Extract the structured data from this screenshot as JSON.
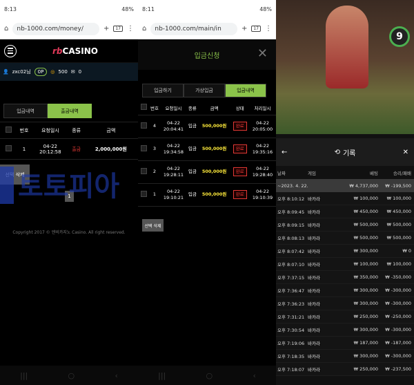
{
  "p1": {
    "status_time": "8:13",
    "status_right": "48%",
    "url": "nb-1000.com/money/",
    "tab_count": "17",
    "logo_prefix": "rb",
    "logo_suffix": "CASINO",
    "user": "zxc02님",
    "point": "0P",
    "coin": "500",
    "msg": "0",
    "tabs": [
      "입금내역",
      "출금내역"
    ],
    "columns": [
      "번호",
      "요청일시",
      "종류",
      "금액"
    ],
    "rows": [
      {
        "no": "1",
        "date": "04-22",
        "time": "20:12:58",
        "type": "출금",
        "amount": "2,000,000원"
      }
    ],
    "delete_label": "선택 삭제",
    "page": "1",
    "copyright": "Copyright 2017 © 엔비카지노 Casino. All right reserved."
  },
  "p2": {
    "status_time": "8:11",
    "status_right": "48%",
    "url": "nb-1000.com/main/in",
    "tab_count": "17",
    "title": "입금신청",
    "tabs": [
      "입금하기",
      "가상입금",
      "입금내역"
    ],
    "columns": [
      "번호",
      "요청일시",
      "종류",
      "금액",
      "상태",
      "처리일시"
    ],
    "rows": [
      {
        "no": "4",
        "date": "04-22",
        "time": "20:04:41",
        "type": "입금",
        "amount": "500,000원",
        "status": "완료",
        "pdate": "04-22",
        "ptime": "20:05:00"
      },
      {
        "no": "3",
        "date": "04-22",
        "time": "19:34:58",
        "type": "입금",
        "amount": "500,000원",
        "status": "완료",
        "pdate": "04-22",
        "ptime": "19:35:16"
      },
      {
        "no": "2",
        "date": "04-22",
        "time": "19:28:11",
        "type": "입금",
        "amount": "500,000원",
        "status": "완료",
        "pdate": "04-22",
        "ptime": "19:28:40"
      },
      {
        "no": "1",
        "date": "04-22",
        "time": "19:10:21",
        "type": "입금",
        "amount": "500,000원",
        "status": "완료",
        "pdate": "04-22",
        "ptime": "19:10:39"
      }
    ],
    "delete_label": "선택 삭제"
  },
  "p3": {
    "timer": "9",
    "title": "기록",
    "columns": [
      "날짜",
      "게임",
      "베팅",
      "승리/패배"
    ],
    "summary": {
      "date": "~2023. 4. 22.",
      "bet": "₩ 4,737,000",
      "win": "₩ -199,500"
    },
    "rows": [
      {
        "time": "오후 8:10:12",
        "game": "바카라",
        "bet": "₩ 100,000",
        "win": "₩ 100,000"
      },
      {
        "time": "오후 8:09:45",
        "game": "바카라",
        "bet": "₩ 450,000",
        "win": "₩ 450,000"
      },
      {
        "time": "오후 8:09:15",
        "game": "바카라",
        "bet": "₩ 500,000",
        "win": "₩ 500,000"
      },
      {
        "time": "오후 8:08:13",
        "game": "바카라",
        "bet": "₩ 500,000",
        "win": "₩ 500,000"
      },
      {
        "time": "오후 8:07:42",
        "game": "바카라",
        "bet": "₩ 300,000",
        "win": "₩ 0"
      },
      {
        "time": "오후 8:07:10",
        "game": "바카라",
        "bet": "₩ 100,000",
        "win": "₩ 100,000"
      },
      {
        "time": "오후 7:37:15",
        "game": "바카라",
        "bet": "₩ 350,000",
        "win": "₩ -350,000"
      },
      {
        "time": "오후 7:36:47",
        "game": "바카라",
        "bet": "₩ 300,000",
        "win": "₩ -300,000"
      },
      {
        "time": "오후 7:36:23",
        "game": "바카라",
        "bet": "₩ 300,000",
        "win": "₩ -300,000"
      },
      {
        "time": "오후 7:31:21",
        "game": "바카라",
        "bet": "₩ 250,000",
        "win": "₩ -250,000"
      },
      {
        "time": "오후 7:30:54",
        "game": "바카라",
        "bet": "₩ 300,000",
        "win": "₩ -300,000"
      },
      {
        "time": "오후 7:19:06",
        "game": "바카라",
        "bet": "₩ 187,000",
        "win": "₩ -187,000"
      },
      {
        "time": "오후 7:18:35",
        "game": "바카라",
        "bet": "₩ 300,000",
        "win": "₩ -300,000"
      },
      {
        "time": "오후 7:18:07",
        "game": "바카라",
        "bet": "₩ 250,000",
        "win": "₩ -237,500"
      }
    ]
  },
  "watermark": "토토피아",
  "colors": {
    "accent": "#8bc34a",
    "red": "#e53935",
    "yellow": "#ffeb3b",
    "watermark": "#1e3aa8"
  }
}
